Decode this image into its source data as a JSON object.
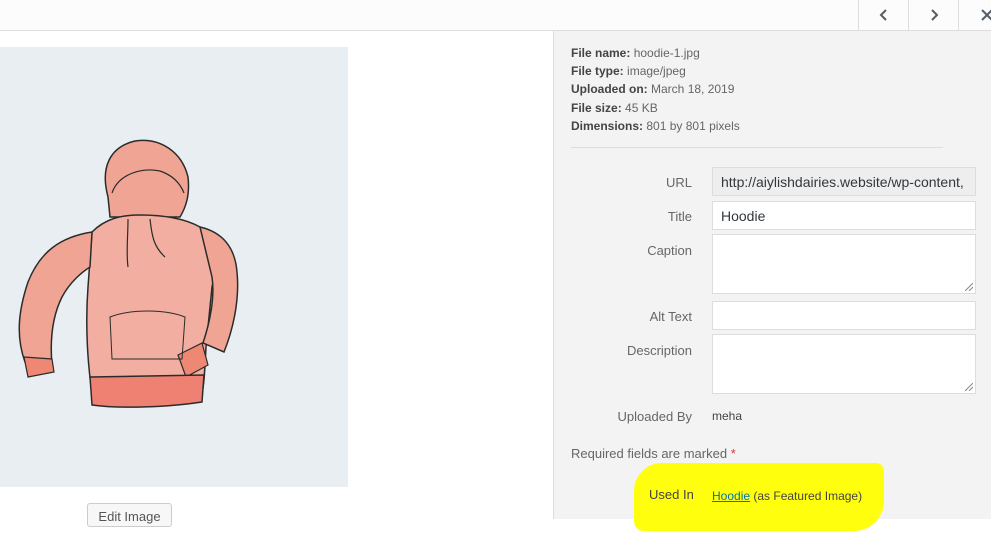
{
  "nav": {
    "prev_icon": "chevron-left-icon",
    "next_icon": "chevron-right-icon",
    "close_icon": "close-icon"
  },
  "preview": {
    "edit_image_label": "Edit Image",
    "image_subject": "hoodie"
  },
  "details": {
    "file_name_label": "File name:",
    "file_name": "hoodie-1.jpg",
    "file_type_label": "File type:",
    "file_type": "image/jpeg",
    "uploaded_on_label": "Uploaded on:",
    "uploaded_on": "March 18, 2019",
    "file_size_label": "File size:",
    "file_size": "45 KB",
    "dimensions_label": "Dimensions:",
    "dimensions": "801 by 801 pixels"
  },
  "fields": {
    "url_label": "URL",
    "url_value": "http://aiylishdairies.website/wp-content,",
    "title_label": "Title",
    "title_value": "Hoodie",
    "caption_label": "Caption",
    "caption_value": "",
    "alt_label": "Alt Text",
    "alt_value": "",
    "description_label": "Description",
    "description_value": "",
    "uploaded_by_label": "Uploaded By",
    "uploaded_by_value": "meha"
  },
  "required_note": "Required fields are marked",
  "required_star": "*",
  "used_in": {
    "label": "Used In",
    "link": "Hoodie",
    "suffix": "(as Featured Image)"
  },
  "colors": {
    "highlight": "#ffff00",
    "link": "#0073aa",
    "required": "#dc3232",
    "hoodie": "#f2a595"
  }
}
